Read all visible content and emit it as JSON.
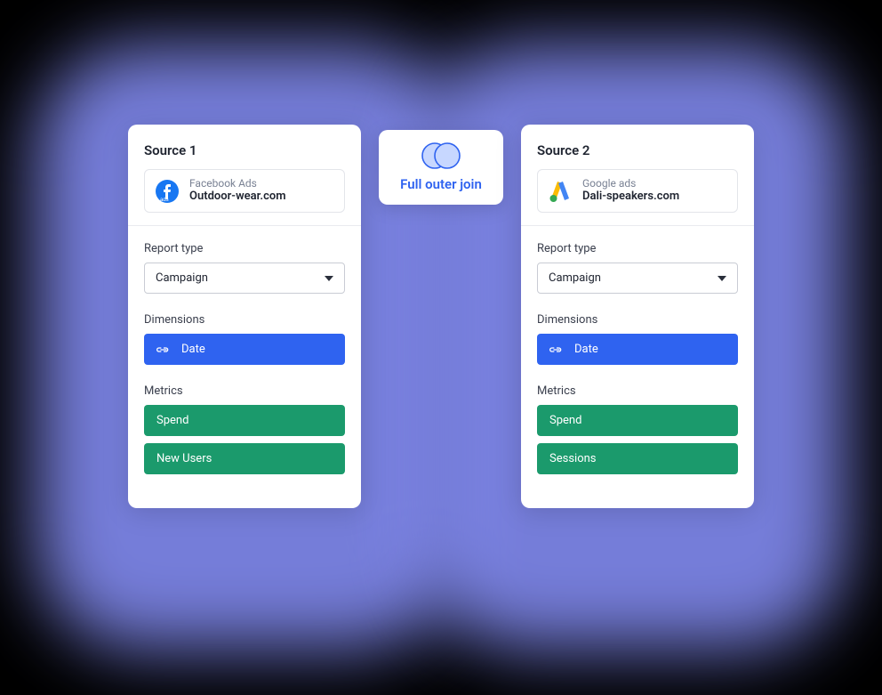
{
  "join": {
    "label": "Full outer join"
  },
  "sources": {
    "s1": {
      "title": "Source 1",
      "platform": "Facebook Ads",
      "account": "Outdoor-wear.com",
      "report_type_label": "Report type",
      "report_type_value": "Campaign",
      "dimensions_label": "Dimensions",
      "dimension": "Date",
      "metrics_label": "Metrics",
      "metric1": "Spend",
      "metric2": "New Users"
    },
    "s2": {
      "title": "Source 2",
      "platform": "Google ads",
      "account": "Dali-speakers.com",
      "report_type_label": "Report type",
      "report_type_value": "Campaign",
      "dimensions_label": "Dimensions",
      "dimension": "Date",
      "metrics_label": "Metrics",
      "metric1": "Spend",
      "metric2": "Sessions"
    }
  }
}
